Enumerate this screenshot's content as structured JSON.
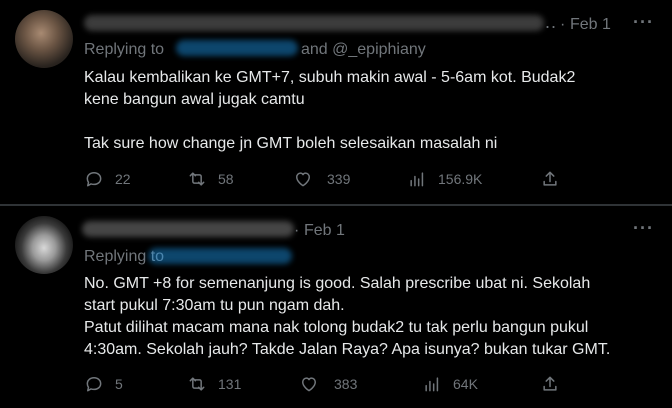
{
  "tweets": [
    {
      "date": "Feb 1",
      "dots": "..",
      "replying_prefix": "Replying to",
      "replying_suffix": "and @_epiphiany",
      "text": "Kalau kembalikan ke GMT+7, subuh makin awal - 5-6am kot. Budak2\nkene bangun awal jugak camtu\n\nTak sure how change jn GMT boleh selesaikan masalah ni",
      "replies": "22",
      "reposts": "58",
      "likes": "339",
      "views": "156.9K"
    },
    {
      "date": "Feb 1",
      "replying_prefix": "Replying to",
      "text": "No. GMT +8 for semenanjung is good. Salah prescribe ubat ni. Sekolah\nstart pukul 7:30am tu pun ngam dah.\nPatut dilihat macam mana nak tolong budak2 tu tak perlu bangun pukul\n4:30am. Sekolah jauh? Takde Jalan Raya? Apa isunya? bukan tukar GMT.",
      "replies": "5",
      "reposts": "131",
      "likes": "383",
      "views": "64K"
    }
  ],
  "more_label": "···",
  "colors": {
    "background": "#000000",
    "text": "#e7e9ea",
    "muted": "#71767b",
    "divider": "#2f3336"
  },
  "icons": [
    "reply-icon",
    "repost-icon",
    "like-icon",
    "views-icon",
    "share-icon",
    "more-icon"
  ]
}
